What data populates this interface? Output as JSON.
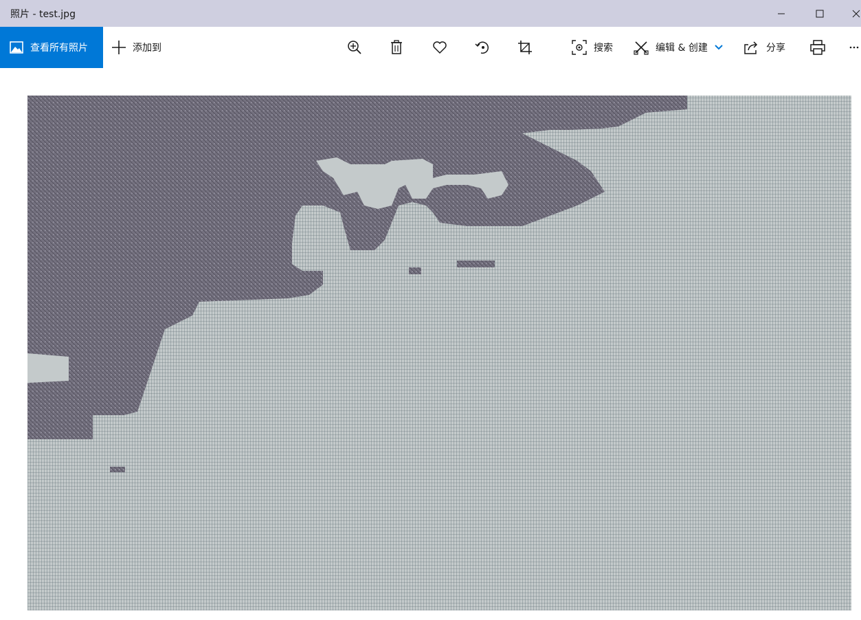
{
  "window": {
    "title": "照片 - test.jpg",
    "controls": [
      "minimize-icon",
      "maximize-icon",
      "close-icon"
    ]
  },
  "toolbar": {
    "view_all_label": "查看所有照片",
    "add_to_label": "添加到",
    "search_label": "搜索",
    "edit_create_label": "编辑 & 创建",
    "share_label": "分享",
    "icons": [
      "zoom-in-icon",
      "delete-icon",
      "favorite-icon",
      "rotate-icon",
      "crop-icon",
      "search-icon",
      "edit-icon",
      "share-icon",
      "print-icon",
      "more-icon"
    ],
    "accent_color": "#0078d7"
  },
  "photo": {
    "file": "test.jpg",
    "colors": {
      "water": "#c4cacb",
      "land": "#74717f"
    }
  }
}
